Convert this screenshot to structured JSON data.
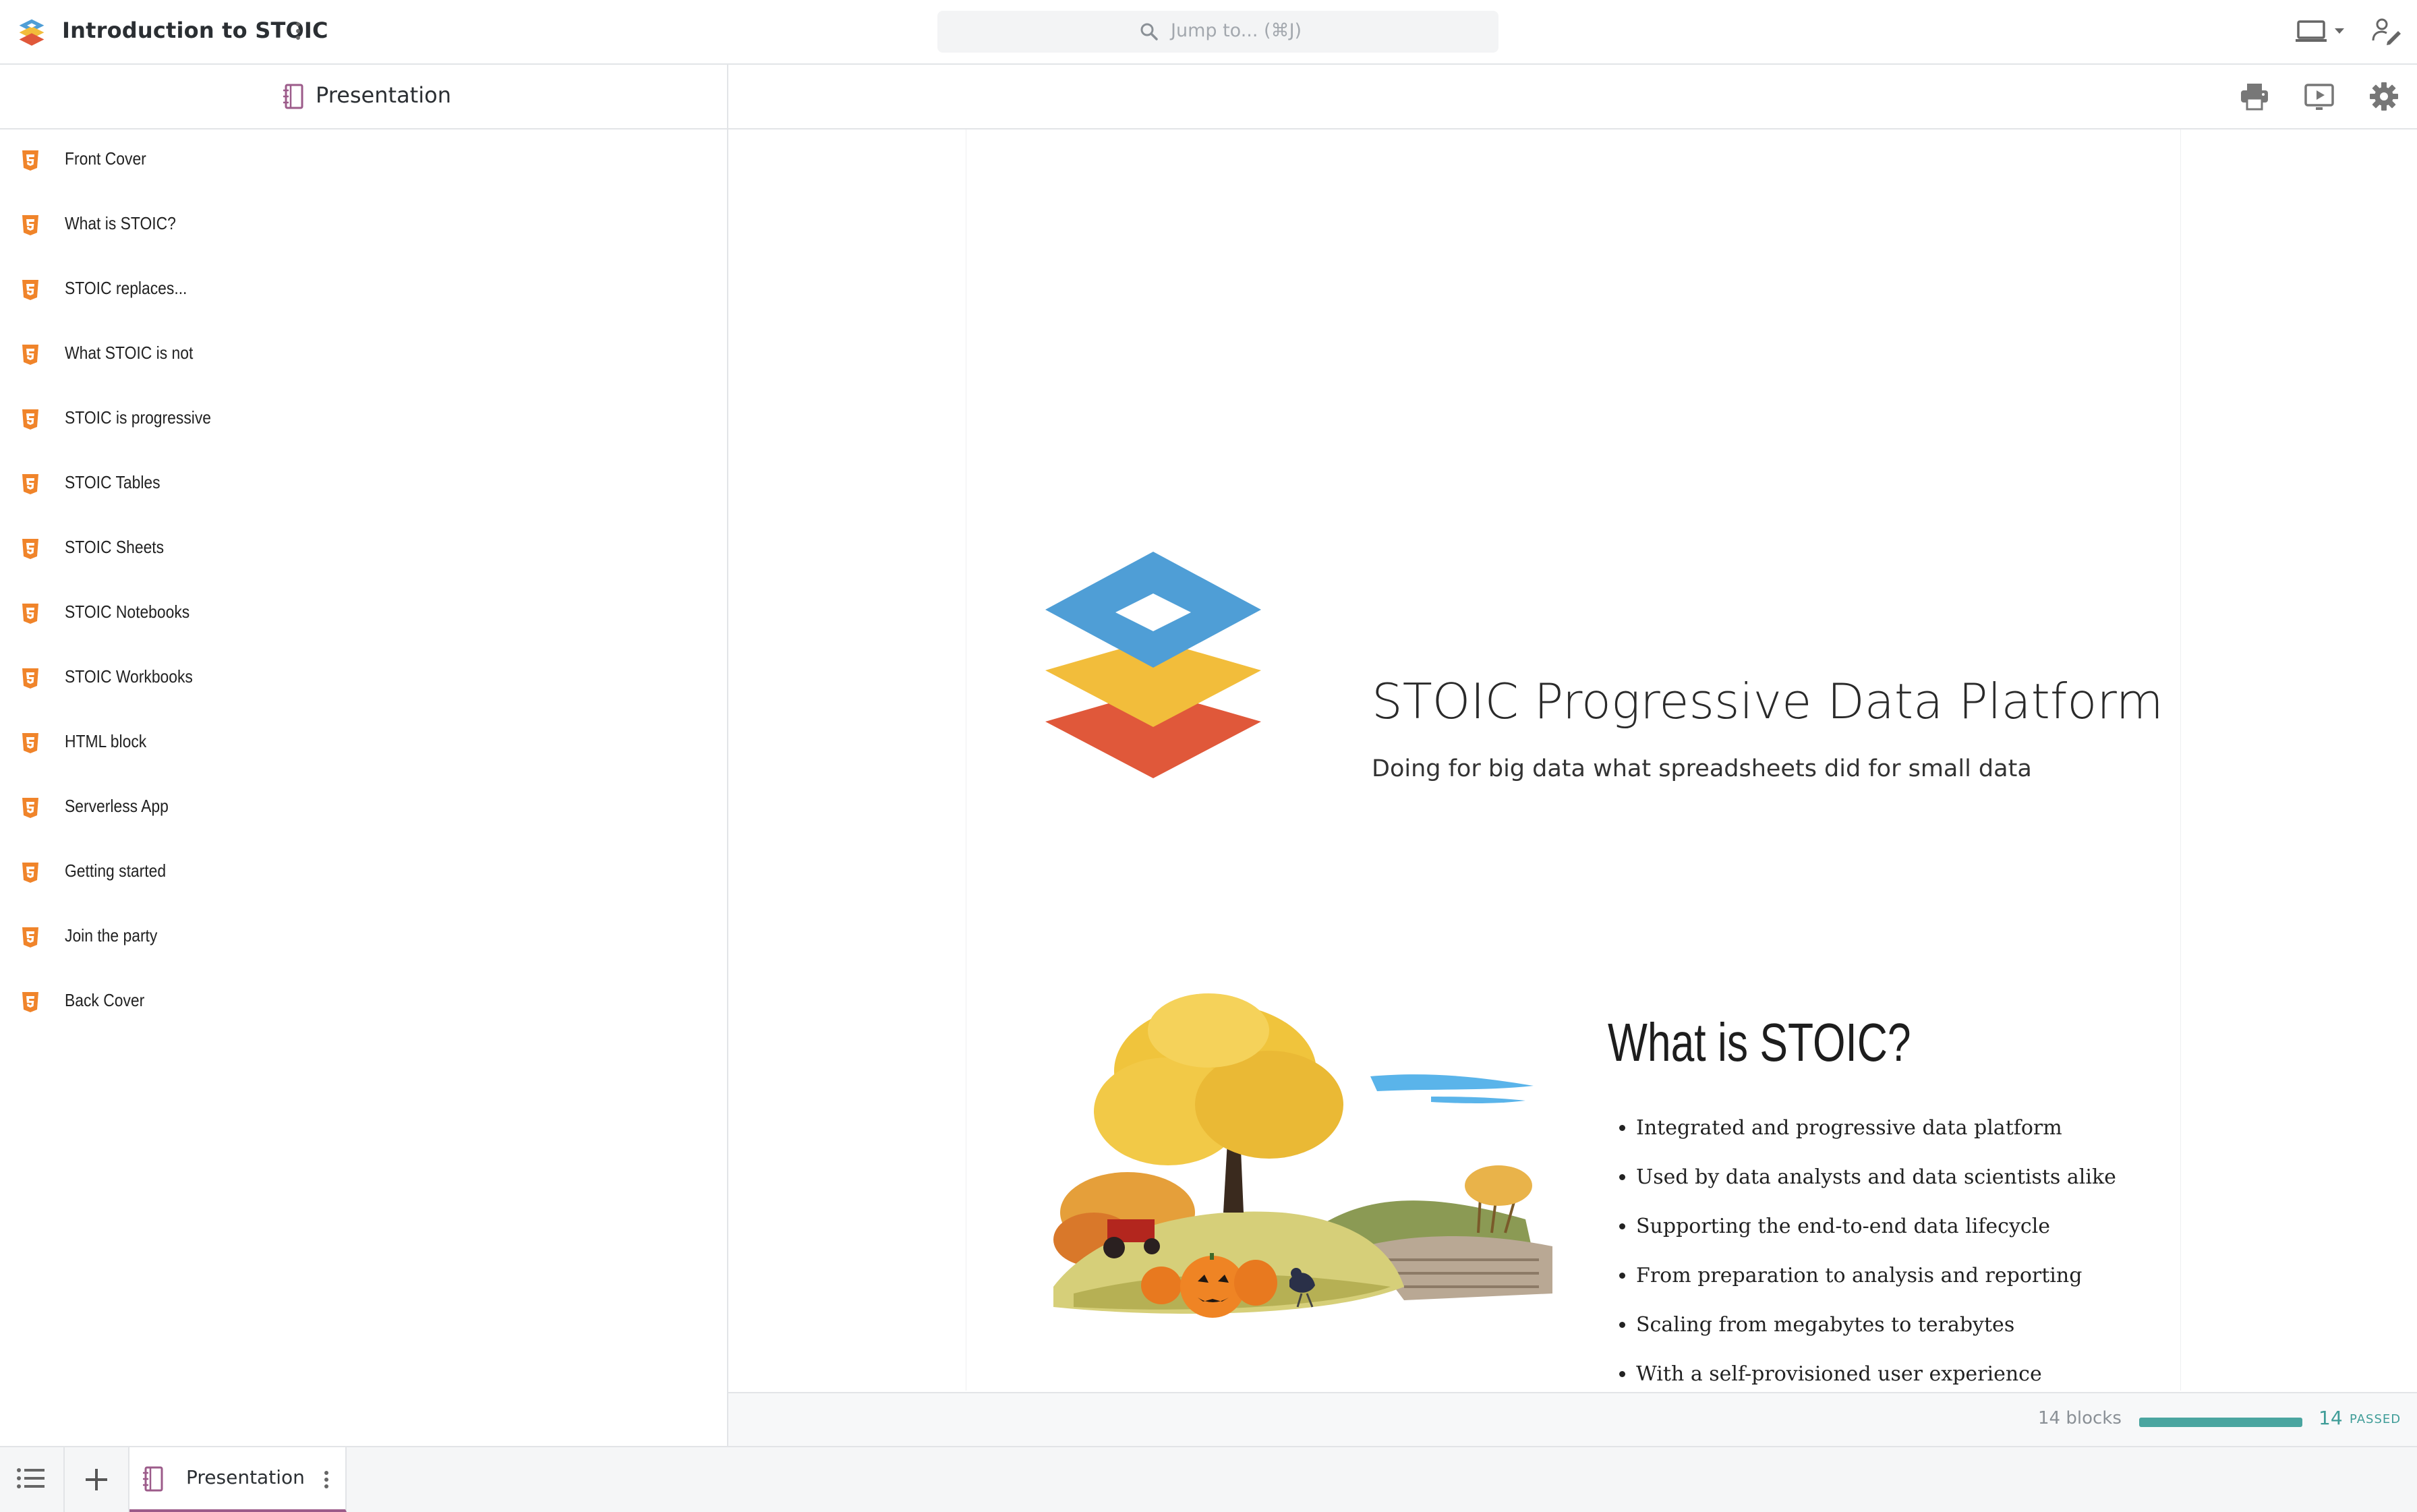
{
  "app": {
    "title": "Introduction to STOIC",
    "search_placeholder": "Jump to... (⌘J)"
  },
  "sidebar": {
    "header_label": "Presentation",
    "items": [
      {
        "label": "Front Cover"
      },
      {
        "label": "What is STOIC?"
      },
      {
        "label": "STOIC replaces..."
      },
      {
        "label": "What STOIC is not"
      },
      {
        "label": "STOIC is progressive"
      },
      {
        "label": "STOIC Tables"
      },
      {
        "label": "STOIC Sheets"
      },
      {
        "label": "STOIC Notebooks"
      },
      {
        "label": "STOIC Workbooks"
      },
      {
        "label": "HTML block"
      },
      {
        "label": "Serverless App"
      },
      {
        "label": "Getting started"
      },
      {
        "label": "Join the party"
      },
      {
        "label": "Back Cover"
      }
    ]
  },
  "toolbar": {
    "icons": [
      "print-icon",
      "present-icon",
      "settings-icon"
    ]
  },
  "slides": {
    "cover": {
      "title": "STOIC Progressive Data Platform",
      "subtitle": "Doing for big data what spreadsheets did for small data"
    },
    "what_is": {
      "title": "What is STOIC?",
      "bullets": [
        "Integrated and progressive data platform",
        "Used by data analysts and data scientists alike",
        "Supporting the end-to-end data lifecycle",
        "From preparation to analysis and reporting",
        "Scaling from megabytes to terabytes",
        "With a self-provisioned user experience"
      ]
    }
  },
  "status": {
    "blocks": "14 blocks",
    "passed_count": "14",
    "passed_label": "PASSED",
    "progress_fraction": 1.0
  },
  "bottom_tabs": {
    "active_tab": "Presentation"
  },
  "colors": {
    "logo_blue": "#4f9ed6",
    "logo_yellow": "#f2bd3b",
    "logo_red": "#e0583a",
    "html_icon": "#f0842a",
    "notebook_icon": "#9c5b8a",
    "passed_teal": "#4aa5a0"
  }
}
